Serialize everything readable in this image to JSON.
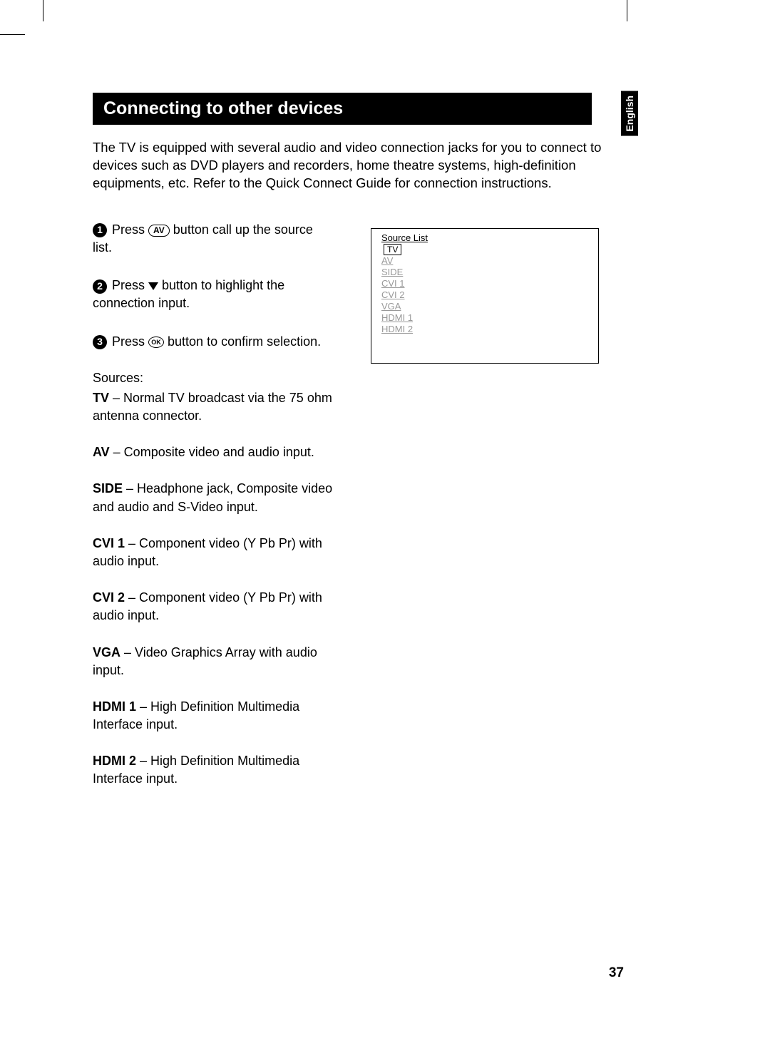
{
  "language_tab": "English",
  "page_number": "37",
  "section_title": "Connecting to other devices",
  "intro": "The TV is equipped with several audio and video connection jacks for you to connect to devices such as DVD players and recorders, home theatre systems, high-definition equipments, etc.  Refer to the Quick Connect Guide for connection instructions.",
  "steps": {
    "s1_a": " Press ",
    "s1_btn": "AV",
    "s1_b": " button call up the source list.",
    "s2_a": " Press ",
    "s2_b": " button to highlight the connection input.",
    "s3_a": " Press ",
    "s3_btn": "OK",
    "s3_b": " button to confirm selection."
  },
  "sources_label": "Sources:",
  "sources": [
    {
      "term": "TV",
      "desc": " – Normal TV broadcast via the 75 ohm antenna connector."
    },
    {
      "term": "AV",
      "desc": " – Composite video and audio input."
    },
    {
      "term": "SIDE",
      "desc": " – Headphone jack, Composite video and audio and S-Video input."
    },
    {
      "term": "CVI 1",
      "desc": " – Component video (Y Pb Pr) with audio input."
    },
    {
      "term": "CVI 2",
      "desc": " – Component video (Y Pb Pr) with audio input."
    },
    {
      "term": "VGA",
      "desc": " – Video Graphics Array with audio input."
    },
    {
      "term": "HDMI 1",
      "desc": " – High Definition Multimedia Interface input."
    },
    {
      "term": "HDMI 2",
      "desc": " – High Definition Multimedia Interface input."
    }
  ],
  "source_list": {
    "header": "Source List",
    "selected": "TV",
    "items": [
      "AV",
      "SIDE",
      "CVI 1",
      "CVI 2",
      "VGA",
      "HDMI 1",
      "HDMI 2"
    ]
  }
}
